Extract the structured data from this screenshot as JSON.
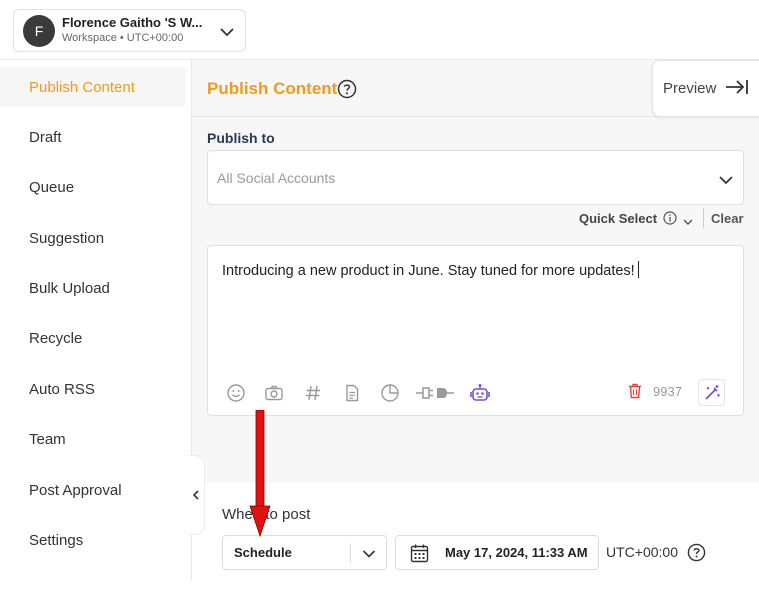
{
  "workspace": {
    "initial": "F",
    "name": "Florence Gaitho 'S W...",
    "subtitle": "Workspace • UTC+00:00"
  },
  "sidebar": {
    "items": [
      {
        "label": "Publish Content",
        "active": true
      },
      {
        "label": "Draft"
      },
      {
        "label": "Queue"
      },
      {
        "label": "Suggestion"
      },
      {
        "label": "Bulk Upload"
      },
      {
        "label": "Recycle"
      },
      {
        "label": "Auto RSS"
      },
      {
        "label": "Team"
      },
      {
        "label": "Post Approval"
      },
      {
        "label": "Settings"
      }
    ]
  },
  "main": {
    "title": "Publish Content",
    "preview_label": "Preview",
    "publish_to_label": "Publish to",
    "accounts_placeholder": "All Social Accounts",
    "quick_select_label": "Quick Select",
    "clear_label": "Clear",
    "post_text": "Introducing a new product in June. Stay tuned for more updates!",
    "char_count": "9937",
    "toolbar_icons": [
      "emoji-icon",
      "camera-icon",
      "hashtag-icon",
      "document-icon",
      "pie-chart-icon",
      "plug-icon",
      "robot-icon"
    ],
    "when_to_post_label": "When to post",
    "schedule_value": "Schedule",
    "datetime_value": "May 17, 2024, 11:33 AM",
    "timezone": "UTC+00:00"
  },
  "colors": {
    "accent": "#f39a1c",
    "arrow": "#e0120f",
    "ai_purple": "#7b4fd1",
    "delete_red": "#e0453a"
  }
}
